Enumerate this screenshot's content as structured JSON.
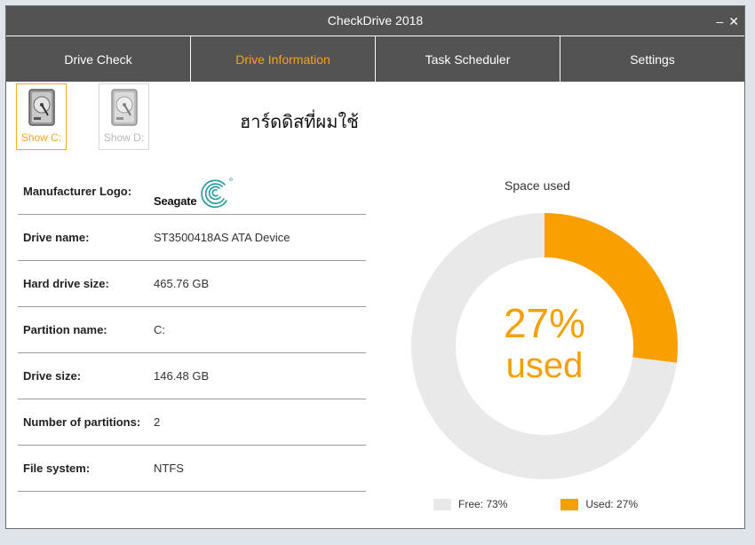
{
  "window": {
    "title": "CheckDrive 2018",
    "minimize": "–",
    "close": "✕"
  },
  "tabs": [
    {
      "label": "Drive Check"
    },
    {
      "label": "Drive Information"
    },
    {
      "label": "Task Scheduler"
    },
    {
      "label": "Settings"
    }
  ],
  "drives": [
    {
      "label": "Show C:",
      "icon": "hard-drive-icon",
      "selected": true
    },
    {
      "label": "Show D:",
      "icon": "hard-drive-icon",
      "selected": false
    }
  ],
  "heading": "ฮาร์ดดิสที่ผมใช้",
  "info": {
    "manufacturer_label": "Manufacturer Logo:",
    "manufacturer_logo_text": "Seagate",
    "drive_name_label": "Drive name:",
    "drive_name": "ST3500418AS ATA Device",
    "hd_size_label": "Hard drive size:",
    "hd_size": "465.76 GB",
    "partition_label": "Partition name:",
    "partition": "C:",
    "drive_size_label": "Drive size:",
    "drive_size": "146.48 GB",
    "num_partitions_label": "Number of partitions:",
    "num_partitions": "2",
    "fs_label": "File system:",
    "fs": "NTFS"
  },
  "chart_data": {
    "type": "pie",
    "title": "Space used",
    "center_value": "27%",
    "center_label": "used",
    "slices": [
      {
        "name": "Free",
        "value": 73,
        "color": "#e9e9e9",
        "legend": "Free: 73%"
      },
      {
        "name": "Used",
        "value": 27,
        "color": "#f9a000",
        "legend": "Used: 27%"
      }
    ],
    "legend_position": "bottom"
  },
  "colors": {
    "accent": "#f5a623",
    "bar": "#535353",
    "used": "#f9a000",
    "free": "#e9e9e9"
  }
}
